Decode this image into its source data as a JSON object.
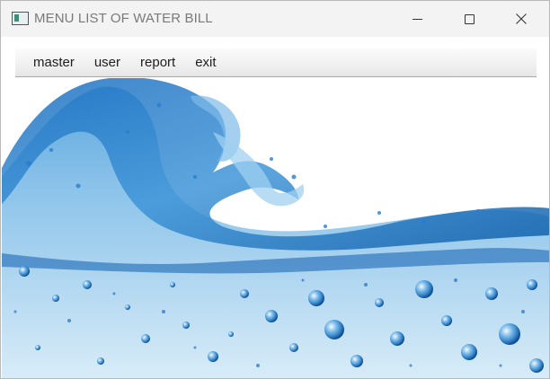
{
  "window": {
    "title": "MENU LIST OF WATER BILL"
  },
  "menu": {
    "items": [
      "master",
      "user",
      "report",
      "exit"
    ]
  },
  "icons": {
    "app": "app-window-icon",
    "minimize": "minimize-icon",
    "maximize": "maximize-icon",
    "close": "close-icon"
  },
  "colors": {
    "titlebar": "#f3f3f3",
    "water_deep": "#0d5fb3",
    "water_mid": "#3d93d6",
    "water_light": "#bcdcf1"
  }
}
